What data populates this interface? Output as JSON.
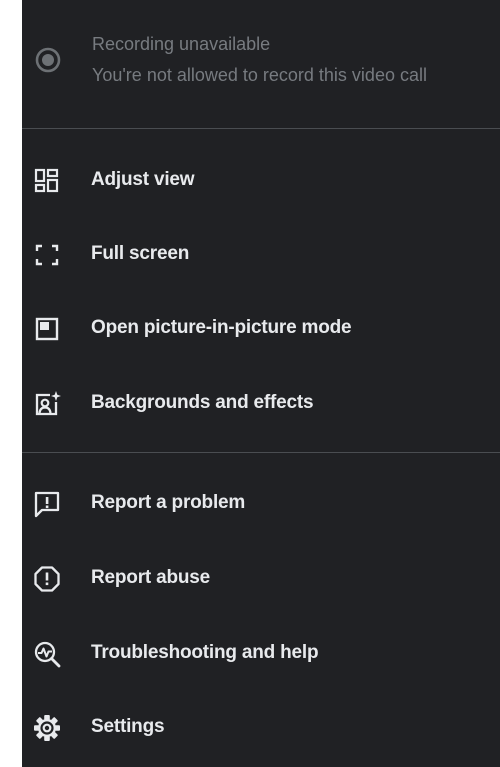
{
  "recording": {
    "icon": "record-icon",
    "title": "Recording unavailable",
    "subtitle": "You're not allowed to record this video call"
  },
  "view_items": [
    {
      "icon": "adjust-view-icon",
      "label": "Adjust view"
    },
    {
      "icon": "fullscreen-icon",
      "label": "Full screen"
    },
    {
      "icon": "picture-in-picture-icon",
      "label": "Open picture-in-picture mode"
    },
    {
      "icon": "backgrounds-effects-icon",
      "label": "Backgrounds and effects"
    }
  ],
  "support_items": [
    {
      "icon": "report-problem-icon",
      "label": "Report a problem"
    },
    {
      "icon": "report-abuse-icon",
      "label": "Report abuse"
    },
    {
      "icon": "troubleshooting-icon",
      "label": "Troubleshooting and help"
    },
    {
      "icon": "settings-icon",
      "label": "Settings"
    }
  ],
  "colors": {
    "menu_background": "#202124",
    "text": "#e8eaed",
    "disabled_text": "#777b80",
    "divider": "#4a4d51"
  }
}
